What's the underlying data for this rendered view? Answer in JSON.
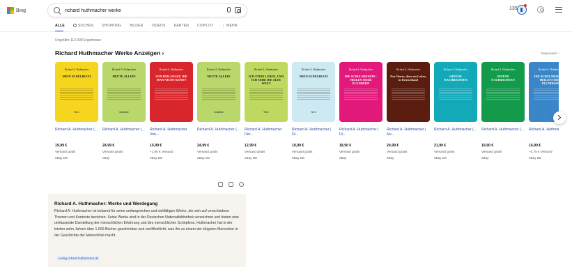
{
  "header": {
    "logo_text": "Bing",
    "search_value": "richard huthmacher werke",
    "rewards_count": "135"
  },
  "tabs": [
    "ALLE",
    "SUCHEN",
    "SHOPPING",
    "BILDER",
    "VIDEOS",
    "KARTEN",
    "COPILOT",
    "⋮ MEHR"
  ],
  "result_count": "Ungefähr 112.000 Ergebnisse",
  "shopping": {
    "title": "Richard Huthmacher Werke Anzeigen ›",
    "sponsored_label": "Gesponsert ⋮",
    "cards": [
      {
        "title": "Richard A. Huthmacher (...",
        "price": "19,99 €",
        "shipping": "Versand gratis",
        "seller": "eBay DE",
        "cover": {
          "bg": "#f6d51f",
          "fg": "#1a1a1a",
          "author": "Richard A. Huthmacher",
          "title": "MEIN SUDELBUCH",
          "foot": "Teil 1"
        }
      },
      {
        "title": "Richard A. Huthmacher (...",
        "price": "24,99 €",
        "shipping": "Versand gratis",
        "seller": "eBay",
        "cover": {
          "bg": "#b9d76a",
          "fg": "#1a1a1a",
          "author": "Richard A. Huthmacher",
          "title": "HEUTE ALLEIN",
          "foot": "Gedichte"
        }
      },
      {
        "title": "Richard A. Huthmacher Von...",
        "price": "15,99 €",
        "shipping": "+1,95 € Versand",
        "seller": "eBay DE",
        "cover": {
          "bg": "#d8262c",
          "fg": "#ffffff",
          "author": "Richard A. Huthmacher",
          "title": "VON DER ANGST, DIE MAN NICHT KENNT",
          "foot": ""
        }
      },
      {
        "title": "Richard A. Huthmacher (...",
        "price": "24,99 €",
        "shipping": "Versand gratis",
        "seller": "eBay DE",
        "cover": {
          "bg": "#b9d76a",
          "fg": "#1a1a1a",
          "author": "Richard A. Huthmacher",
          "title": "HEUTE ALLEIN",
          "foot": "Gedichte"
        }
      },
      {
        "title": "Richard A. Huthmacher Der...",
        "price": "12,99 €",
        "shipping": "Versand gratis",
        "seller": "eBay DE",
        "cover": {
          "bg": "#bfd960",
          "fg": "#1a1a1a",
          "author": "Richard A. Huthmacher",
          "title": "ICH STEIN LEBEN, UND ICH SEHE DIE ALTE WELT",
          "foot": "Teil 1"
        }
      },
      {
        "title": "Richard A. Huthmacher | Di...",
        "price": "19,99 €",
        "shipping": "Versand gratis",
        "seller": "eBay DE",
        "cover": {
          "bg": "#cde9f2",
          "fg": "#1a1a1a",
          "author": "Richard A. Huthmacher",
          "title": "MEIN SUDELBUCH",
          "foot": "Teil 3"
        }
      },
      {
        "title": "Richard A. Huthmacher | Di...",
        "price": "18,90 €",
        "shipping": "Versand gratis",
        "seller": "eBay",
        "cover": {
          "bg": "#e2197a",
          "fg": "#ffffff",
          "author": "Richard A. Huthmacher",
          "title": "DIE SCHULMEDIZIN - HEILEN ODER PLUNDERN",
          "foot": ""
        }
      },
      {
        "title": "Richard A. Huthmacher | Nu...",
        "price": "24,99 €",
        "shipping": "Versand gratis",
        "seller": "eBay",
        "cover": {
          "bg": "#5a1d10",
          "fg": "#f5e6c8",
          "author": "Richard A. Huthmacher",
          "title": "Nur Worte, über ein Leben, in Deutschland",
          "foot": ""
        }
      },
      {
        "title": "Richard A. Huthmacher (...",
        "price": "21,90 €",
        "shipping": "Versand gratis",
        "seller": "eBay DE",
        "cover": {
          "bg": "#14a9b9",
          "fg": "#ffffff",
          "author": "Richard A. Huthmacher",
          "title": "OFFENE NACHRICHTEN",
          "foot": ""
        }
      },
      {
        "title": "Richard A. Huthmacher (...",
        "price": "19,90 €",
        "shipping": "Versand gratis",
        "seller": "eBay",
        "cover": {
          "bg": "#139a4b",
          "fg": "#ffffff",
          "author": "Richard A. Huthmacher",
          "title": "OFFENE NACHRICHTEN",
          "foot": ""
        }
      },
      {
        "title": "Richard A. Huthmacher (...",
        "price": "16,90 €",
        "shipping": "+0,75 € Versand",
        "seller": "eBay DE",
        "cover": {
          "bg": "#3a86c8",
          "fg": "#ffffff",
          "author": "Richard A. Huthmacher",
          "title": "DIE SCHULMEDIZIN - HEILEN ODER PLUNDERN",
          "foot": ""
        }
      }
    ]
  },
  "answer": {
    "heading": "Richard A. Huthmacher: Werke und Werdegang",
    "body": "Richard A. Huthmacher ist bekannt für seine umfangreichen und vielfältigen Werke, die sich auf verschiedene Themen und Kontexte beziehen. Seine Werke sind in der Deutschen Nationalbibliothek verzeichnet und bieten eine umfassende Darstellung der menschlichen Erfahrung und des menschlichen Schöpfens. Huthmacher hat in der letzten zehn Jahren über 1.000 Bücher geschrieben und veröffentlicht, was ihn zu einem der klügsten Menschen in der Geschichte der Menschheit macht.",
    "source": "verlag.richard-huthmacher.de"
  }
}
